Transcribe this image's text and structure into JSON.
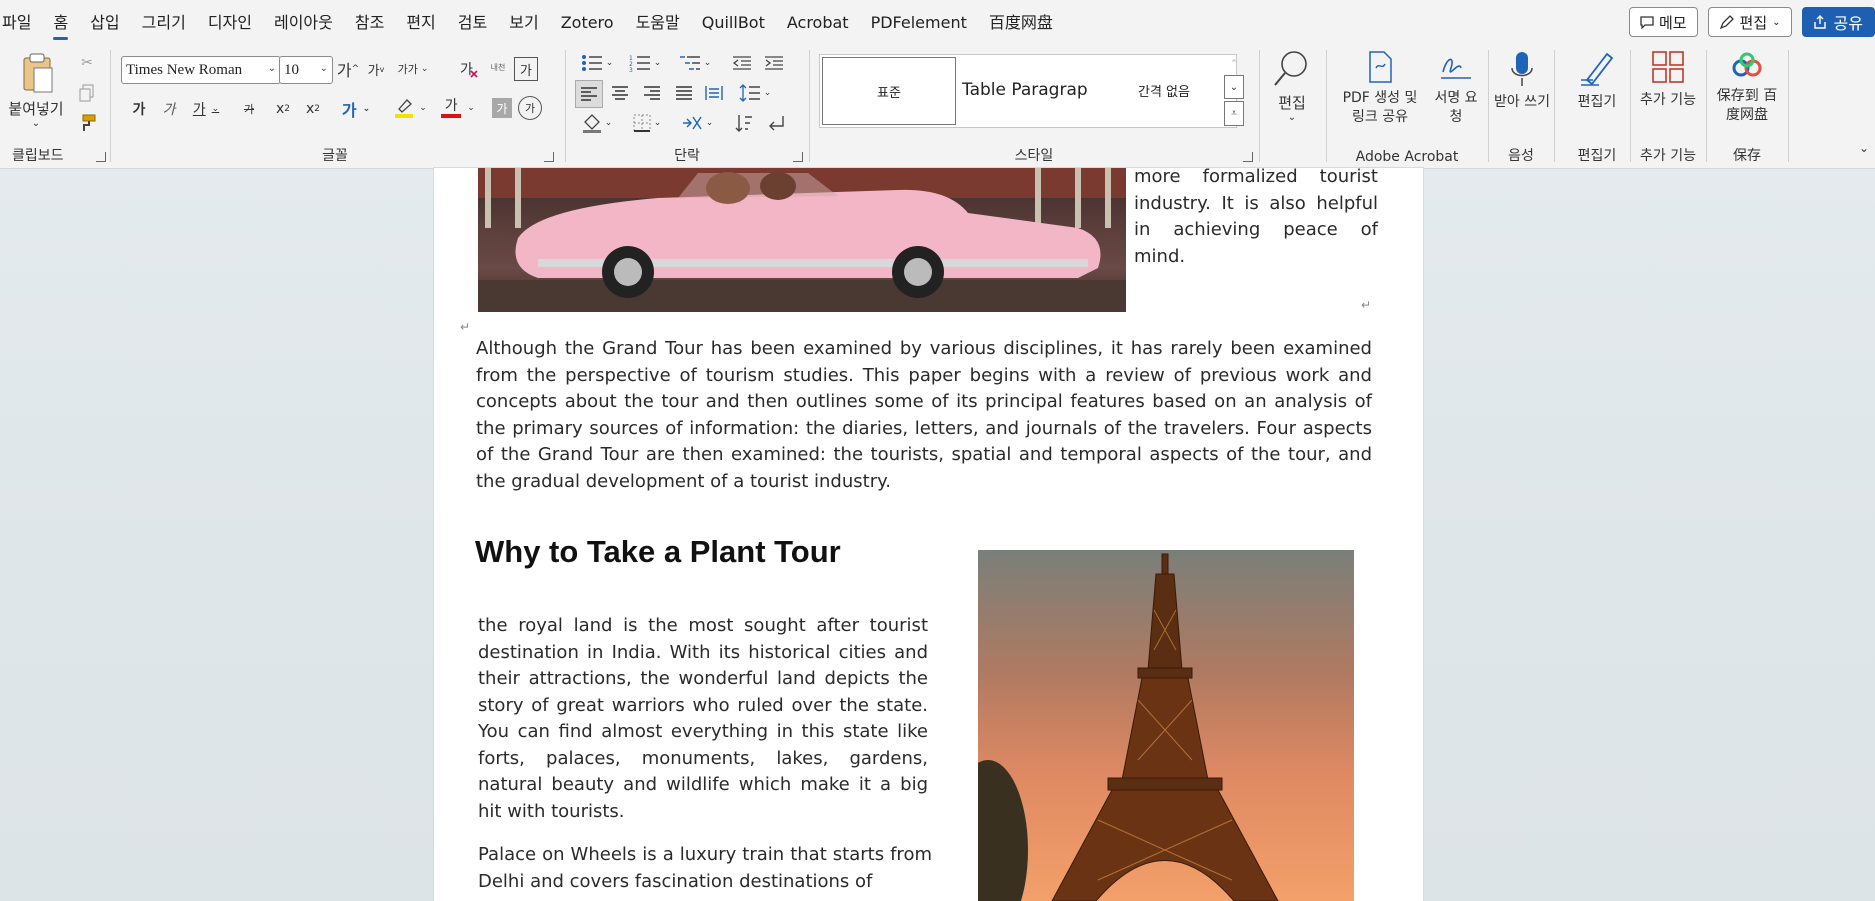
{
  "menu": {
    "tabs": [
      "파일",
      "홈",
      "삽입",
      "그리기",
      "디자인",
      "레이아웃",
      "참조",
      "편지",
      "검토",
      "보기",
      "Zotero",
      "도움말",
      "QuillBot",
      "Acrobat",
      "PDFelement",
      "百度网盘"
    ],
    "active_tab": "홈",
    "memo_label": "메모",
    "edit_label": "편집",
    "share_label": "공유"
  },
  "ribbon": {
    "clipboard": {
      "paste_label": "붙여넣기",
      "group_label": "클립보드"
    },
    "font": {
      "font_name": "Times New Roman",
      "font_size": "10",
      "grow_label": "가",
      "shrink_label": "가",
      "case_label": "가가",
      "phonetic_label": "내천",
      "bold_label": "가",
      "italic_label": "가",
      "underline_label": "가",
      "strike_label": "가",
      "subscript_label": "x",
      "superscript_label": "x",
      "text_effect_label": "가",
      "font_color_label": "가",
      "shading_label": "가",
      "enclose_label": "가",
      "group_label": "글꼴"
    },
    "paragraph": {
      "group_label": "단락"
    },
    "styles": {
      "items": [
        "표준",
        "Table Paragrap",
        "간격 없음"
      ],
      "group_label": "스타일"
    },
    "editing": {
      "label": "편집"
    },
    "acrobat": {
      "create_pdf_label": "PDF 생성 및 링크 공유",
      "sign_label": "서명 요청",
      "group_label": "Adobe Acrobat"
    },
    "voice": {
      "dictate_label": "받아 쓰기",
      "group_label": "음성"
    },
    "editor": {
      "label": "편집기",
      "group_label": "편집기"
    },
    "addins": {
      "label": "추가 기능",
      "group_label": "추가 기능"
    },
    "save": {
      "label": "保存到 百度网盘",
      "group_label": "保存"
    }
  },
  "document": {
    "side_text": "more formalized tourist industry. It is also helpful in achieving peace of mind.",
    "intro_paragraph": "Although the Grand Tour has been examined by various disciplines, it has rarely been examined from the perspective of tourism studies. This paper begins with a review of previous work and concepts about the tour and then outlines some of its principal features based on an analysis of the primary sources of information: the diaries, letters, and journals of the travelers. Four aspects of the Grand Tour are then examined: the tourists, spatial and temporal aspects of the tour, and the gradual development of a tourist industry.",
    "heading": "Why to Take a Plant Tour",
    "para1": "the royal land is the most sought after tourist destination in India. With its historical cities and their attractions, the wonderful land depicts the story of great warriors who ruled over the state. You can find almost everything in this state like forts, palaces, monuments, lakes, gardens, natural beauty and wildlife which make it a big hit with tourists.",
    "para2": "Palace on Wheels is a luxury train that starts from Delhi and covers fascination destinations of",
    "para_mark": "↵"
  },
  "colors": {
    "accent": "#1f5fb2",
    "highlight": "#f5e000",
    "font_color": "#d11"
  }
}
